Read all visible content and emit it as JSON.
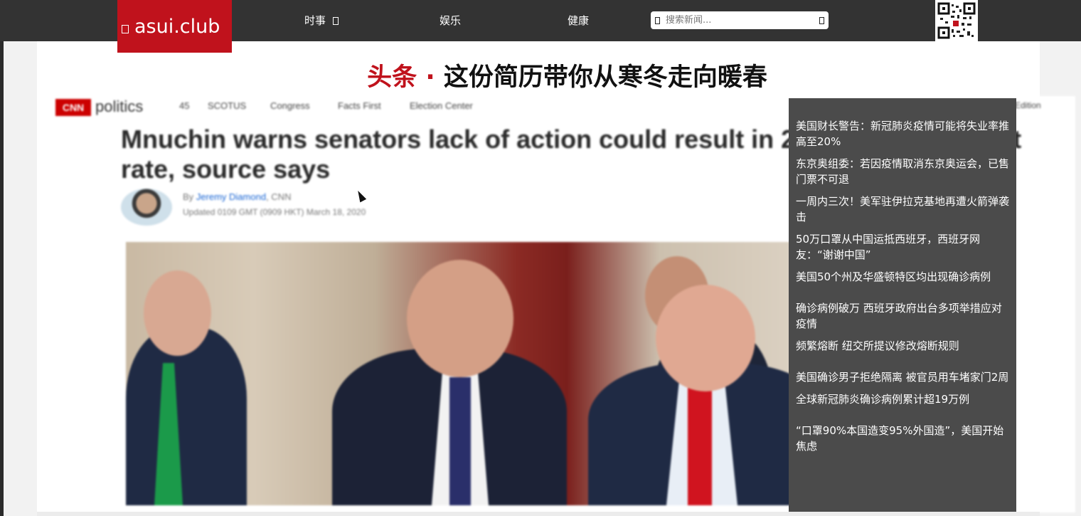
{
  "site": {
    "logo_text": "asui.club"
  },
  "nav": {
    "items": [
      {
        "label": "时事"
      },
      {
        "label": "娱乐"
      },
      {
        "label": "健康"
      }
    ],
    "search_placeholder": "搜索新闻..."
  },
  "headline": {
    "tag": "头条",
    "separator": "·",
    "title": "这份简历带你从寒冬走向暖春"
  },
  "article": {
    "cnn_logo": "CNN",
    "cnn_section": "politics",
    "cnn_nav": [
      "45",
      "SCOTUS",
      "Congress",
      "Facts First",
      "Election Center"
    ],
    "edition": "Edition",
    "title": "Mnuchin warns senators lack of action could result in 20% unemployment rate, source says",
    "byline_prefix": "By",
    "author": "Jeremy Diamond",
    "outlet": ", CNN",
    "updated": "Updated 0109 GMT (0909 HKT) March 18, 2020"
  },
  "news_list": [
    "美国财长警告：新冠肺炎疫情可能将失业率推高至20%",
    "东京奥组委：若因疫情取消东京奥运会，已售门票不可退",
    "一周内三次！美军驻伊拉克基地再遭火箭弹袭击",
    "50万口罩从中国运抵西班牙，西班牙网友：“谢谢中国”",
    "美国50个州及华盛顿特区均出现确诊病例",
    "确诊病例破万 西班牙政府出台多项举措应对疫情",
    "频繁熔断 纽交所提议修改熔断规则",
    "美国确诊男子拒绝隔离 被官员用车堵家门2周",
    "全球新冠肺炎确诊病例累计超19万例",
    "“口罩90%本国造变95%外国造”，美国开始焦虑"
  ],
  "colors": {
    "brand_red": "#c0121c",
    "topbar": "#333333",
    "news_panel": "#4b4b4b"
  }
}
